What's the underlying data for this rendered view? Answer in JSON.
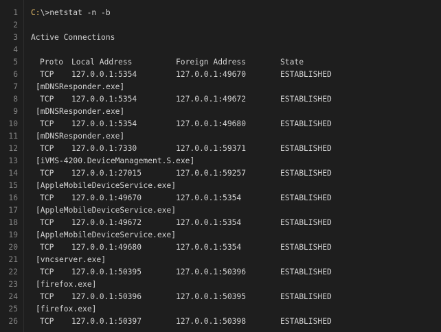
{
  "editor": {
    "line_numbers": [
      "1",
      "2",
      "3",
      "4",
      "5",
      "6",
      "7",
      "8",
      "9",
      "10",
      "11",
      "12",
      "13",
      "14",
      "15",
      "16",
      "17",
      "18",
      "19",
      "20",
      "21",
      "22",
      "23",
      "24",
      "25",
      "26"
    ],
    "command": {
      "drive": "C:",
      "rest": "\\>netstat -n -b"
    },
    "heading": "Active Connections",
    "columns": {
      "proto": "Proto",
      "local": "Local Address",
      "foreign": "Foreign Address",
      "state": "State"
    },
    "connections": [
      {
        "proto": "TCP",
        "local": "127.0.0.1:5354",
        "foreign": "127.0.0.1:49670",
        "state": "ESTABLISHED",
        "exe": "[mDNSResponder.exe]"
      },
      {
        "proto": "TCP",
        "local": "127.0.0.1:5354",
        "foreign": "127.0.0.1:49672",
        "state": "ESTABLISHED",
        "exe": "[mDNSResponder.exe]"
      },
      {
        "proto": "TCP",
        "local": "127.0.0.1:5354",
        "foreign": "127.0.0.1:49680",
        "state": "ESTABLISHED",
        "exe": "[mDNSResponder.exe]"
      },
      {
        "proto": "TCP",
        "local": "127.0.0.1:7330",
        "foreign": "127.0.0.1:59371",
        "state": "ESTABLISHED",
        "exe": "[iVMS-4200.DeviceManagement.S.exe]"
      },
      {
        "proto": "TCP",
        "local": "127.0.0.1:27015",
        "foreign": "127.0.0.1:59257",
        "state": "ESTABLISHED",
        "exe": "[AppleMobileDeviceService.exe]"
      },
      {
        "proto": "TCP",
        "local": "127.0.0.1:49670",
        "foreign": "127.0.0.1:5354",
        "state": "ESTABLISHED",
        "exe": "[AppleMobileDeviceService.exe]"
      },
      {
        "proto": "TCP",
        "local": "127.0.0.1:49672",
        "foreign": "127.0.0.1:5354",
        "state": "ESTABLISHED",
        "exe": "[AppleMobileDeviceService.exe]"
      },
      {
        "proto": "TCP",
        "local": "127.0.0.1:49680",
        "foreign": "127.0.0.1:5354",
        "state": "ESTABLISHED",
        "exe": "[vncserver.exe]"
      },
      {
        "proto": "TCP",
        "local": "127.0.0.1:50395",
        "foreign": "127.0.0.1:50396",
        "state": "ESTABLISHED",
        "exe": "[firefox.exe]"
      },
      {
        "proto": "TCP",
        "local": "127.0.0.1:50396",
        "foreign": "127.0.0.1:50395",
        "state": "ESTABLISHED",
        "exe": "[firefox.exe]"
      },
      {
        "proto": "TCP",
        "local": "127.0.0.1:50397",
        "foreign": "127.0.0.1:50398",
        "state": "ESTABLISHED",
        "exe": ""
      }
    ]
  },
  "colors": {
    "background": "#1e1e1e",
    "text": "#d4d4d4",
    "line_number": "#858585",
    "drive_highlight": "#e8bf6a"
  }
}
